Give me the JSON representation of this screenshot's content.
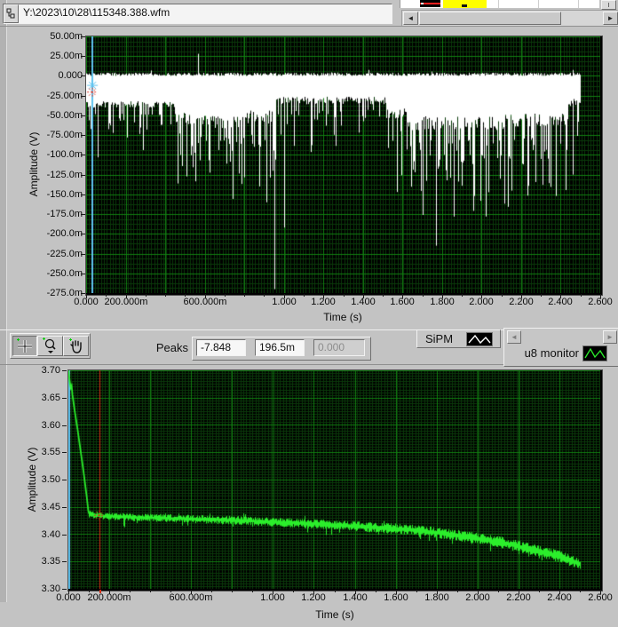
{
  "path_bar": {
    "value": "Y:\\2023\\10\\28\\115348.388.wfm"
  },
  "file_row": {
    "swatch_color": "#000000",
    "swatch_line_color": "#ff2020",
    "selected_cell_color": "#ffff00"
  },
  "toolbar": {
    "peaks_label": "Peaks",
    "peaks_values": [
      "-7.848",
      "196.5m",
      "0.000"
    ],
    "palette_tools": [
      "cursor-tool",
      "zoom-tool",
      "pan-tool"
    ]
  },
  "legend_top": {
    "label": "SiPM",
    "color": "#ffffff"
  },
  "legend_bottom": {
    "label": "u8 monitor",
    "color": "#2bee2b"
  },
  "chart_data": [
    {
      "id": "sipm",
      "type": "line",
      "name": "SiPM",
      "xlabel": "Time (s)",
      "ylabel": "Amplitude (V)",
      "xlim": [
        0,
        2.6
      ],
      "ylim": [
        -0.275,
        0.05
      ],
      "line_color": "#ffffff",
      "grid": {
        "major_dx": 0.2,
        "minor_dx": 0.015,
        "major_dy": 0.025,
        "minor_dy": 0.00625,
        "major_color": "#117f11",
        "minor_color": "#0a3a0a",
        "background": "#000000"
      },
      "yticks": [
        {
          "v": 0.05,
          "label": "50.00m"
        },
        {
          "v": 0.025,
          "label": "25.00m"
        },
        {
          "v": 0,
          "label": "0.000"
        },
        {
          "v": -0.025,
          "label": "-25.00m"
        },
        {
          "v": -0.05,
          "label": "-50.00m"
        },
        {
          "v": -0.075,
          "label": "-75.00m"
        },
        {
          "v": -0.1,
          "label": "-100.0m"
        },
        {
          "v": -0.125,
          "label": "-125.0m"
        },
        {
          "v": -0.15,
          "label": "-150.0m"
        },
        {
          "v": -0.175,
          "label": "-175.0m"
        },
        {
          "v": -0.2,
          "label": "-200.0m"
        },
        {
          "v": -0.225,
          "label": "-225.0m"
        },
        {
          "v": -0.25,
          "label": "-250.0m"
        },
        {
          "v": -0.275,
          "label": "-275.0m"
        }
      ],
      "xticks": [
        {
          "v": 0,
          "label": "0.000"
        },
        {
          "v": 0.1
        },
        {
          "v": 0.2,
          "label": "200.000m"
        },
        {
          "v": 0.3
        },
        {
          "v": 0.4
        },
        {
          "v": 0.5
        },
        {
          "v": 0.6,
          "label": "600.000m"
        },
        {
          "v": 0.7
        },
        {
          "v": 0.8
        },
        {
          "v": 0.9
        },
        {
          "v": 1.0,
          "label": "1.000"
        },
        {
          "v": 1.1
        },
        {
          "v": 1.2,
          "label": "1.200"
        },
        {
          "v": 1.3
        },
        {
          "v": 1.4,
          "label": "1.400"
        },
        {
          "v": 1.5
        },
        {
          "v": 1.6,
          "label": "1.600"
        },
        {
          "v": 1.7
        },
        {
          "v": 1.8,
          "label": "1.800"
        },
        {
          "v": 1.9
        },
        {
          "v": 2.0,
          "label": "2.000"
        },
        {
          "v": 2.1
        },
        {
          "v": 2.2,
          "label": "2.200"
        },
        {
          "v": 2.3
        },
        {
          "v": 2.4,
          "label": "2.400"
        },
        {
          "v": 2.5
        },
        {
          "v": 2.6,
          "label": "2.600"
        }
      ],
      "signal": {
        "t_end": 2.5,
        "top_base": 0.0,
        "top_noise": 0.004,
        "segments": [
          [
            0.0,
            0.45,
            -0.036,
            0.006,
            0.075,
            0.18
          ],
          [
            0.45,
            0.62,
            -0.055,
            0.012,
            0.115,
            0.35
          ],
          [
            0.62,
            0.8,
            -0.058,
            0.012,
            0.125,
            0.35
          ],
          [
            0.8,
            0.96,
            -0.052,
            0.012,
            0.15,
            0.3
          ],
          [
            0.96,
            1.52,
            -0.031,
            0.007,
            0.08,
            0.22
          ],
          [
            1.52,
            1.62,
            -0.048,
            0.01,
            0.12,
            0.3
          ],
          [
            1.62,
            2.12,
            -0.06,
            0.013,
            0.14,
            0.38
          ],
          [
            2.12,
            2.44,
            -0.056,
            0.012,
            0.15,
            0.38
          ],
          [
            2.44,
            2.5,
            -0.034,
            0.008,
            0.06,
            0.15
          ]
        ],
        "events": [
          [
            0.565,
            0.028
          ],
          [
            0.91,
            -0.16
          ],
          [
            0.953,
            -0.27
          ],
          [
            1.0,
            -0.192
          ],
          [
            1.57,
            -0.147
          ],
          [
            1.77,
            -0.215
          ],
          [
            2.02,
            -0.178
          ],
          [
            2.31,
            -0.138
          ],
          [
            2.375,
            -0.152
          ],
          [
            2.46,
            -0.125
          ]
        ]
      },
      "cursors": [
        {
          "t": 0.032,
          "line": true,
          "color": "#5fc3ef",
          "marker_v": -0.012,
          "dashed": false
        },
        {
          "t": 0.032,
          "line": false,
          "color": "#e03222",
          "marker_v": -0.0205,
          "dashed": true
        }
      ]
    },
    {
      "id": "u8-monitor",
      "type": "line",
      "name": "u8 monitor",
      "xlabel": "Time (s)",
      "ylabel": "Amplitude (V)",
      "xlim": [
        0,
        2.6
      ],
      "ylim": [
        3.3,
        3.7
      ],
      "line_color": "#2bee2b",
      "grid": {
        "major_dx": 0.2,
        "minor_dx": 0.015,
        "major_dy": 0.05,
        "minor_dy": 0.005,
        "major_color": "#117f11",
        "minor_color": "#0a3a0a",
        "background": "#000000"
      },
      "yticks": [
        {
          "v": 3.7,
          "label": "3.70"
        },
        {
          "v": 3.65,
          "label": "3.65"
        },
        {
          "v": 3.6,
          "label": "3.60"
        },
        {
          "v": 3.55,
          "label": "3.55"
        },
        {
          "v": 3.5,
          "label": "3.50"
        },
        {
          "v": 3.45,
          "label": "3.45"
        },
        {
          "v": 3.4,
          "label": "3.40"
        },
        {
          "v": 3.35,
          "label": "3.35"
        },
        {
          "v": 3.3,
          "label": "3.30"
        }
      ],
      "xticks": [
        {
          "v": 0,
          "label": "0.000"
        },
        {
          "v": 0.1
        },
        {
          "v": 0.2,
          "label": "200.000m"
        },
        {
          "v": 0.3
        },
        {
          "v": 0.4
        },
        {
          "v": 0.5
        },
        {
          "v": 0.6,
          "label": "600.000m"
        },
        {
          "v": 0.7
        },
        {
          "v": 0.8
        },
        {
          "v": 0.9
        },
        {
          "v": 1.0,
          "label": "1.000"
        },
        {
          "v": 1.1
        },
        {
          "v": 1.2,
          "label": "1.200"
        },
        {
          "v": 1.3
        },
        {
          "v": 1.4,
          "label": "1.400"
        },
        {
          "v": 1.5
        },
        {
          "v": 1.6,
          "label": "1.600"
        },
        {
          "v": 1.7
        },
        {
          "v": 1.8,
          "label": "1.800"
        },
        {
          "v": 1.9
        },
        {
          "v": 2.0,
          "label": "2.000"
        },
        {
          "v": 2.1
        },
        {
          "v": 2.2,
          "label": "2.200"
        },
        {
          "v": 2.3
        },
        {
          "v": 2.4,
          "label": "2.400"
        },
        {
          "v": 2.5
        },
        {
          "v": 2.6,
          "label": "2.600"
        }
      ],
      "signal": {
        "t_end": 2.505,
        "start_path": [
          [
            0.0,
            3.7
          ],
          [
            0.008,
            3.676
          ],
          [
            0.012,
            3.668
          ],
          [
            0.016,
            3.672
          ],
          [
            0.02,
            3.655
          ],
          [
            0.03,
            3.628
          ],
          [
            0.045,
            3.592
          ],
          [
            0.06,
            3.552
          ],
          [
            0.075,
            3.512
          ],
          [
            0.09,
            3.468
          ],
          [
            0.097,
            3.444
          ],
          [
            0.102,
            3.437
          ]
        ],
        "trend": [
          [
            0.1,
            3.437
          ],
          [
            0.155,
            3.434
          ],
          [
            0.3,
            3.431
          ],
          [
            0.5,
            3.429
          ],
          [
            0.7,
            3.427
          ],
          [
            0.9,
            3.424
          ],
          [
            1.0,
            3.422
          ],
          [
            1.2,
            3.419
          ],
          [
            1.4,
            3.415
          ],
          [
            1.5,
            3.412
          ],
          [
            1.6,
            3.41
          ],
          [
            1.7,
            3.407
          ],
          [
            1.8,
            3.403
          ],
          [
            1.9,
            3.398
          ],
          [
            2.0,
            3.392
          ],
          [
            2.1,
            3.386
          ],
          [
            2.2,
            3.378
          ],
          [
            2.3,
            3.369
          ],
          [
            2.4,
            3.359
          ],
          [
            2.45,
            3.353
          ],
          [
            2.505,
            3.345
          ]
        ],
        "noise": 0.006
      },
      "cursors": [
        {
          "t": 0.0018,
          "line": true,
          "color": "#5fc3ef",
          "dashed": false
        },
        {
          "t": 0.152,
          "line": true,
          "color": "#d93016",
          "marker_v": 3.4345,
          "dashed": true
        }
      ]
    }
  ]
}
